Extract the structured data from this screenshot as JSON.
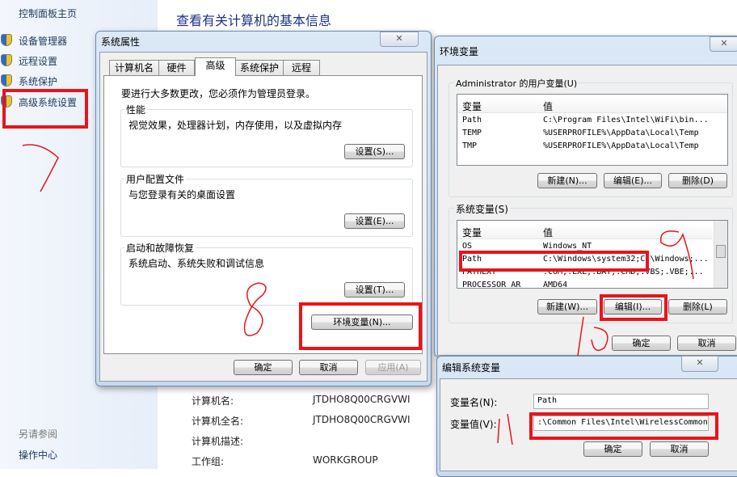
{
  "sidebar": {
    "home": "控制面板主页",
    "items": [
      {
        "label": "设备管理器",
        "icon": "uac-shield-icon"
      },
      {
        "label": "远程设置",
        "icon": "uac-shield-icon"
      },
      {
        "label": "系统保护",
        "icon": "uac-shield-icon"
      },
      {
        "label": "高级系统设置",
        "icon": "uac-shield-icon"
      }
    ],
    "see_also": "另请参阅",
    "action_center": "操作中心"
  },
  "main": {
    "title": "查看有关计算机的基本信息",
    "info": [
      {
        "label": "计算机名:",
        "value": "JTDHO8Q00CRGVWI"
      },
      {
        "label": "计算机全名:",
        "value": "JTDHO8Q00CRGVWI"
      },
      {
        "label": "计算机描述:",
        "value": ""
      },
      {
        "label": "工作组:",
        "value": "WORKGROUP"
      }
    ]
  },
  "sysprops": {
    "title": "系统属性",
    "close": "✕",
    "tabs": [
      "计算机名",
      "硬件",
      "高级",
      "系统保护",
      "远程"
    ],
    "selected_tab": "高级",
    "admin_note": "要进行大多数更改，您必须作为管理员登录。",
    "groups": [
      {
        "title": "性能",
        "desc": "视觉效果，处理器计划，内存使用，以及虚拟内存",
        "button": "设置(S)..."
      },
      {
        "title": "用户配置文件",
        "desc": "与您登录有关的桌面设置",
        "button": "设置(E)..."
      },
      {
        "title": "启动和故障恢复",
        "desc": "系统启动、系统失败和调试信息",
        "button": "设置(T)..."
      }
    ],
    "env_button": "环境变量(N)...",
    "ok": "确定",
    "cancel": "取消",
    "apply": "应用(A)"
  },
  "envvars": {
    "title": "环境变量",
    "close": "✕",
    "user_group": "Administrator 的用户变量(U)",
    "col_var": "变量",
    "col_val": "值",
    "user_rows": [
      {
        "name": "Path",
        "value": "C:\\Program Files\\Intel\\WiFi\\bin..."
      },
      {
        "name": "TEMP",
        "value": "%USERPROFILE%\\AppData\\Local\\Temp"
      },
      {
        "name": "TMP",
        "value": "%USERPROFILE%\\AppData\\Local\\Temp"
      }
    ],
    "user_buttons": [
      "新建(N)...",
      "编辑(E)...",
      "删除(D)"
    ],
    "sys_group": "系统变量(S)",
    "sys_rows": [
      {
        "name": "OS",
        "value": "Windows_NT"
      },
      {
        "name": "Path",
        "value": "C:\\Windows\\system32;C:\\Windows;..."
      },
      {
        "name": "PATHEXT",
        "value": ".COM;.EXE;.BAT;.CMD;.VBS;.VBE;..."
      },
      {
        "name": "PROCESSOR_AR",
        "value": "AMD64"
      }
    ],
    "sys_buttons": [
      "新建(W)...",
      "编辑(I)...",
      "删除(L)"
    ],
    "ok": "确定",
    "cancel": "取消"
  },
  "editvar": {
    "title": "编辑系统变量",
    "close": "✕",
    "name_label": "变量名(N):",
    "name_value": "Path",
    "value_label": "变量值(V):",
    "value_value": ":\\Common Files\\Intel\\WirelessCommon\\",
    "ok": "确定",
    "cancel": "取消"
  },
  "annotations": {
    "step7": "7",
    "step8": "8",
    "step9": "9",
    "step10": "10",
    "step11": "11",
    "color": "#e8141c"
  }
}
